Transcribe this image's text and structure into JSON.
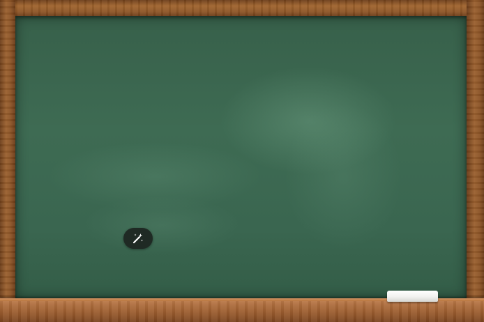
{
  "window": {
    "title": ""
  },
  "board": {
    "surface_color": "#3e6b53",
    "frame_color": "#8e5628",
    "ledge_color": "#b06f3f",
    "chalk_color": "#f1f1ef"
  },
  "toolbar": {
    "magic_button_icon": "magic-wand-icon"
  }
}
